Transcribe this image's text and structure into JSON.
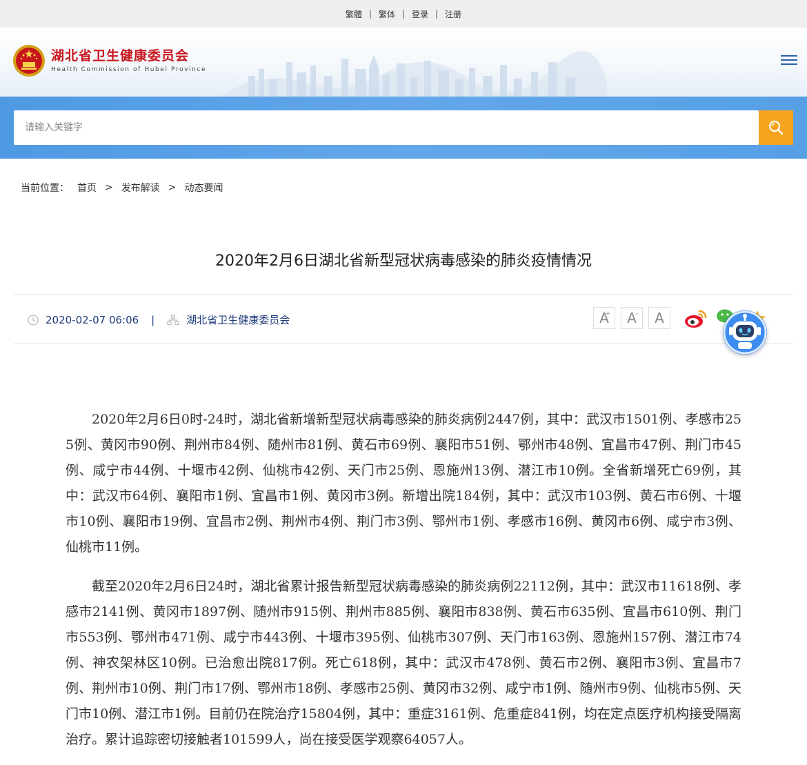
{
  "topbar": {
    "links": [
      "繁體",
      "繁体",
      "登录",
      "注册"
    ],
    "separator": "|"
  },
  "header": {
    "org_name_cn": "湖北省卫生健康委员会",
    "org_name_en": "Health Commission of Hubei Province",
    "emblem_icon": "national-emblem-icon",
    "menu_icon": "hamburger-menu-icon"
  },
  "search": {
    "placeholder": "请输入关键字",
    "value": "",
    "button_icon": "search-icon",
    "button_color": "#f6a31e",
    "band_color": "#57a0e6"
  },
  "breadcrumb": {
    "label": "当前位置：",
    "items": [
      "首页",
      "发布解读",
      "动态要闻"
    ],
    "separator": ">"
  },
  "article": {
    "title": "2020年2月6日湖北省新型冠状病毒感染的肺炎疫情情况",
    "date": "2020-02-07 06:06",
    "meta_sep": "|",
    "source": "湖北省卫生健康委员会",
    "font_controls": [
      "A",
      "A",
      "A"
    ],
    "font_control_marks": [
      "+",
      "-"
    ],
    "share_icons": [
      "weibo-icon",
      "wechat-icon",
      "favorite-icon"
    ],
    "paragraphs": [
      "2020年2月6日0时-24时，湖北省新增新型冠状病毒感染的肺炎病例2447例，其中：武汉市1501例、孝感市255例、黄冈市90例、荆州市84例、随州市81例、黄石市69例、襄阳市51例、鄂州市48例、宜昌市47例、荆门市45例、咸宁市44例、十堰市42例、仙桃市42例、天门市25例、恩施州13例、潜江市10例。全省新增死亡69例，其中：武汉市64例、襄阳市1例、宜昌市1例、黄冈市3例。新增出院184例，其中：武汉市103例、黄石市6例、十堰市10例、襄阳市19例、宜昌市2例、荆州市4例、荆门市3例、鄂州市1例、孝感市16例、黄冈市6例、咸宁市3例、仙桃市11例。",
      "截至2020年2月6日24时，湖北省累计报告新型冠状病毒感染的肺炎病例22112例，其中：武汉市11618例、孝感市2141例、黄冈市1897例、随州市915例、荆州市885例、襄阳市838例、黄石市635例、宜昌市610例、荆门市553例、鄂州市471例、咸宁市443例、十堰市395例、仙桃市307例、天门市163例、恩施州157例、潜江市74例、神农架林区10例。已治愈出院817例。死亡618例，其中：武汉市478例、黄石市2例、襄阳市3例、宜昌市7例、荆州市10例、荆门市17例、鄂州市18例、孝感市25例、黄冈市32例、咸宁市1例、随州市9例、仙桃市5例、天门市10例、潜江市1例。目前仍在院治疗15804例，其中：重症3161例、危重症841例，均在定点医疗机构接受隔离治疗。累计追踪密切接触者101599人，尚在接受医学观察64057人。"
    ]
  },
  "assistant": {
    "icon": "robot-assistant-icon",
    "color": "#3d8cf0"
  }
}
